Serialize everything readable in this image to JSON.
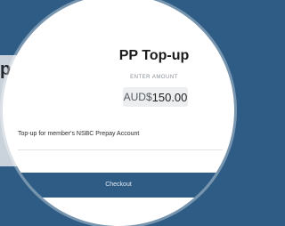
{
  "background": {
    "fragment_text": "p",
    "page_color": "#2f5c84",
    "panel_color": "#c9d1da"
  },
  "card": {
    "title": "PP Top-up",
    "enter_amount_label": "ENTER AMOUNT",
    "amount": {
      "currency": "AUD$",
      "value": "150.00"
    },
    "description": "Top-up for member's NSBC Prepay Account",
    "checkout_label": "Checkout"
  },
  "colors": {
    "accent": "#2f5c84",
    "amount_field_bg": "#eceef0"
  }
}
